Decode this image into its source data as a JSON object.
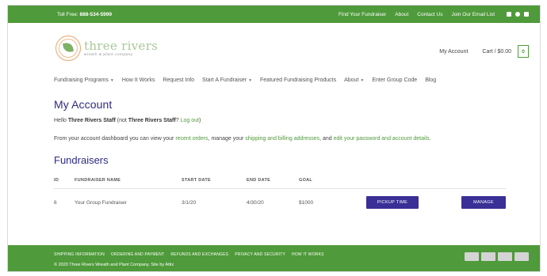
{
  "topbar": {
    "phone_label": "Toll Free:",
    "phone_number": "888-534-5999",
    "links": [
      "Find Your Fundraiser",
      "About",
      "Contact Us",
      "Join Our Email List"
    ],
    "social_icons": [
      "facebook-icon",
      "pinterest-icon",
      "instagram-icon"
    ]
  },
  "header": {
    "logo_name": "three rivers",
    "logo_sub": "wreath & plant company",
    "my_account": "My Account",
    "cart_label": "Cart / $0.00",
    "cart_count": "0"
  },
  "nav": [
    {
      "label": "Fundraising Programs",
      "dropdown": true
    },
    {
      "label": "How It Works",
      "dropdown": false
    },
    {
      "label": "Request Info",
      "dropdown": false
    },
    {
      "label": "Start A Fundraiser",
      "dropdown": true
    },
    {
      "label": "Featured Fundraising Products",
      "dropdown": false
    },
    {
      "label": "About",
      "dropdown": true
    },
    {
      "label": "Enter Group Code",
      "dropdown": false
    },
    {
      "label": "Blog",
      "dropdown": false
    }
  ],
  "account": {
    "title": "My Account",
    "hello_prefix": "Hello",
    "user": "Three Rivers Staff",
    "not_prefix": "(not",
    "not_user": "Three Rivers Staff",
    "not_suffix": "?",
    "logout": "Log out",
    "close_paren": ")",
    "desc_1": "From your account dashboard you can view your",
    "desc_link_1": "recent orders",
    "desc_2": ", manage your",
    "desc_link_2": "shipping and billing addresses",
    "desc_3": ", and",
    "desc_link_3": "edit your password and account details",
    "desc_4": "."
  },
  "fundraisers": {
    "title": "Fundraisers",
    "columns": [
      "ID",
      "FUNDRAISER NAME",
      "START DATE",
      "END DATE",
      "GOAL"
    ],
    "rows": [
      {
        "id": "6",
        "name": "Your Group Fundraiser",
        "start": "3/1/20",
        "end": "4/30/20",
        "goal": "$1000",
        "action_1": "PICKUP TIME",
        "action_2": "MANAGE"
      }
    ]
  },
  "footer": {
    "links": [
      "SHIPPING INFORMATION",
      "ORDERING AND PAYMENT",
      "REFUNDS AND EXCHANGES",
      "PRIVACY AND SECURITY",
      "HOW IT WORKS"
    ],
    "copyright": "© 2020 Three Rivers Wreath and Plant Company. Site by Attix",
    "payment_icons": [
      "visa-icon",
      "mastercard-icon",
      "amex-icon",
      "paypal-icon"
    ]
  },
  "colors": {
    "brand_green": "#4f9a3a",
    "brand_purple": "#2e2a86",
    "button_purple": "#3a2f96"
  }
}
